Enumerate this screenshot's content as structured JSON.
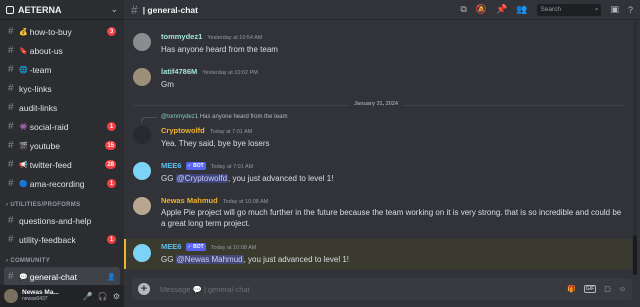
{
  "server": {
    "name": "AETERNA"
  },
  "channels": [
    {
      "label": "how-to-buy",
      "emoji": "💰",
      "badge": "3"
    },
    {
      "label": "about-us",
      "emoji": "🔖",
      "badge": ""
    },
    {
      "label": "-team",
      "emoji": "🌐",
      "badge": ""
    },
    {
      "label": "kyc-links",
      "emoji": "",
      "badge": ""
    },
    {
      "label": "audit-links",
      "emoji": "",
      "badge": ""
    },
    {
      "label": "social-raid",
      "emoji": "👾",
      "badge": "1"
    },
    {
      "label": "youtube",
      "emoji": "🎬",
      "badge": "15"
    },
    {
      "label": "twitter-feed",
      "emoji": "📢",
      "badge": "28"
    },
    {
      "label": "ama-recording",
      "emoji": "🔵",
      "badge": "1"
    }
  ],
  "category_utilities": "UTILITIES/PROFORMS",
  "utility_channels": [
    {
      "label": "questions-and-help",
      "badge": ""
    },
    {
      "label": "utility-feedback",
      "badge": "1"
    }
  ],
  "category_community": "COMMUNITY",
  "active_channel": {
    "label": "general-chat",
    "emoji": "💬"
  },
  "user": {
    "name": "Newas Ma...",
    "tag": "newas0437"
  },
  "topbar": {
    "title": "| general-chat",
    "search_placeholder": "Search"
  },
  "date_divider": "January 31, 2024",
  "messages": [
    {
      "author": "tommydez1",
      "author_color": "#a3e4d7",
      "time": "Yesterday at 10:54 AM",
      "text": "Has anyone heard from the team"
    },
    {
      "author": "latif4786M",
      "author_color": "#a3e4d7",
      "time": "Yesterday at 10:02 PM",
      "text": "Gm"
    },
    {
      "reply_author": "@tommydez1",
      "reply_text": "Has anyone heard from the team",
      "author": "Cryptowolfd",
      "author_color": "#f0b232",
      "time": "Today at 7:01 AM",
      "text": "Yea. They said, bye bye losers"
    },
    {
      "author": "MEE6",
      "author_color": "#5bc0f0",
      "bot": "✓ BOT",
      "time": "Today at 7:01 AM",
      "text_prefix": "GG ",
      "mention": "@Cryptowolfd",
      "text_suffix": ", you just advanced to level 1!"
    },
    {
      "author": "Newas Mahmud",
      "author_color": "#f0b232",
      "time": "Today at 10:08 AM",
      "text": "Apple Pie project will go much further in the future because the team working on it is very strong. that is so incredible and could be a great long term project."
    },
    {
      "author": "MEE6",
      "author_color": "#5bc0f0",
      "bot": "✓ BOT",
      "time": "Today at 10:08 AM",
      "text_prefix": "GG ",
      "mention": "@Newas Mahmud",
      "text_suffix": ", you just advanced to level 1!"
    }
  ],
  "composer": {
    "placeholder": "Message 💬 | general-chat",
    "gif": "GIF"
  }
}
